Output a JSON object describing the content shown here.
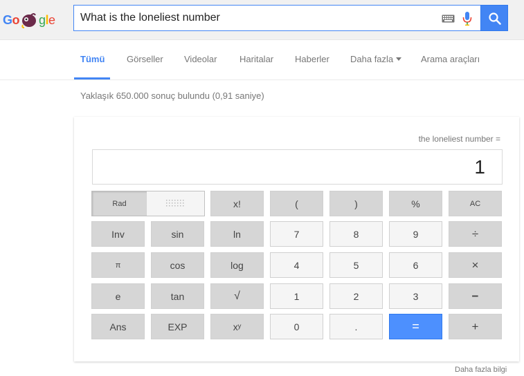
{
  "search": {
    "query": "What is the loneliest number"
  },
  "nav": {
    "tabs": [
      {
        "label": "Tümü",
        "active": true
      },
      {
        "label": "Görseller"
      },
      {
        "label": "Videolar"
      },
      {
        "label": "Haritalar"
      },
      {
        "label": "Haberler"
      },
      {
        "label": "Daha fazla"
      },
      {
        "label": "Arama araçları"
      }
    ]
  },
  "results": {
    "stats": "Yaklaşık 650.000 sonuç bulundu (0,91 saniye)"
  },
  "calculator": {
    "expression": "the loneliest number =",
    "display": "1",
    "rad_label": "Rad",
    "keys": {
      "fact": "x!",
      "lparen": "(",
      "rparen": ")",
      "percent": "%",
      "ac": "AC",
      "inv": "Inv",
      "sin": "sin",
      "ln": "ln",
      "seven": "7",
      "eight": "8",
      "nine": "9",
      "divide": "÷",
      "pi": "π",
      "cos": "cos",
      "log": "log",
      "four": "4",
      "five": "5",
      "six": "6",
      "multiply": "×",
      "e": "e",
      "tan": "tan",
      "sqrt": "√",
      "one": "1",
      "two": "2",
      "three": "3",
      "minus": "−",
      "ans": "Ans",
      "exp": "EXP",
      "power": "xʸ",
      "zero": "0",
      "dot": ".",
      "equals": "=",
      "plus": "+"
    }
  },
  "footer": {
    "more_info": "Daha fazla bilgi"
  },
  "colors": {
    "accent": "#4285f4",
    "equals_key": "#4d90fe"
  }
}
